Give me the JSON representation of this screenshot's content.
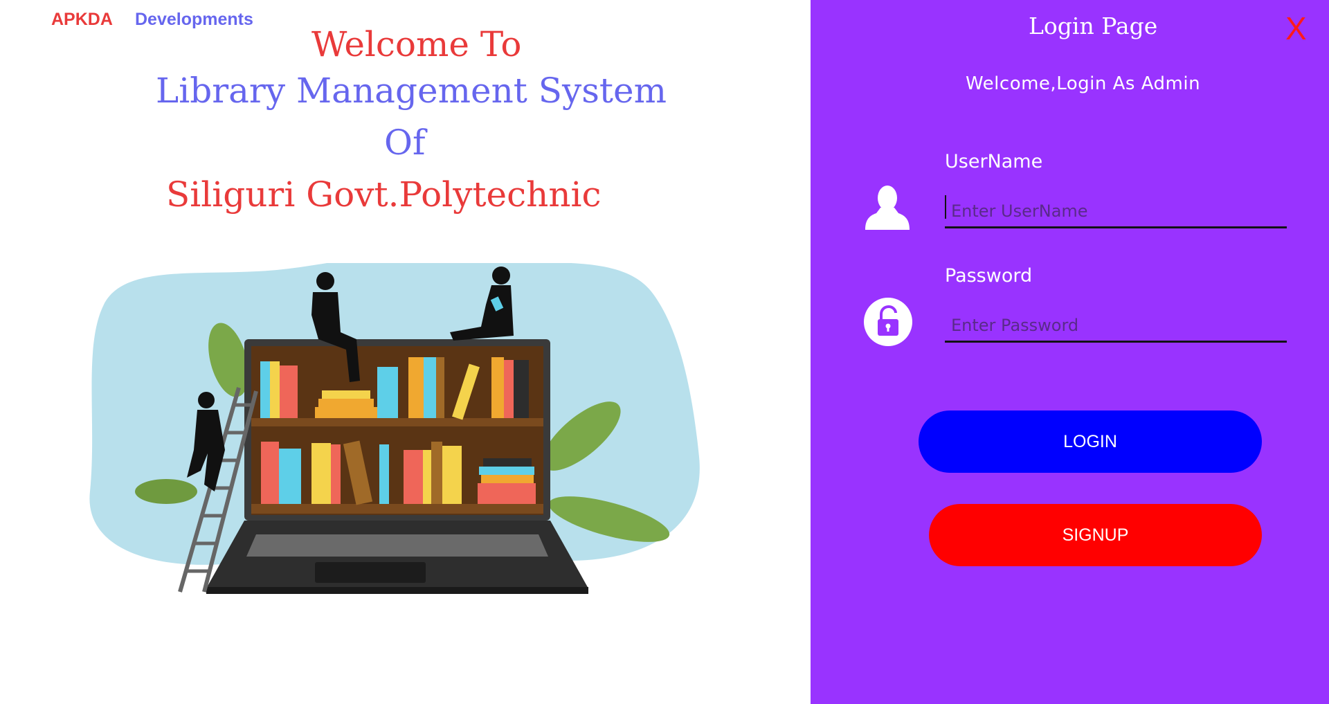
{
  "brand": {
    "part1": "APKDA",
    "part2": "Developments"
  },
  "welcome": {
    "line1": "Welcome To",
    "line2": "Library Management System",
    "line3": "Of",
    "line4": "Siliguri Govt.Polytechnic"
  },
  "login_panel": {
    "title": "Login Page",
    "close_label": "X",
    "subtitle": "Welcome,Login As Admin",
    "username_label": "UserName",
    "username_placeholder": "Enter UserName",
    "password_label": "Password",
    "password_placeholder": "Enter Password",
    "login_button": "LOGIN",
    "signup_button": "SIGNUP"
  },
  "icons": [
    "user-icon",
    "lock-icon"
  ],
  "colors": {
    "panel_bg": "#9933ff",
    "login_button": "#0000ff",
    "signup_button": "#ff0000",
    "heading_red": "#e93a3a",
    "heading_blue": "#6666ee"
  }
}
